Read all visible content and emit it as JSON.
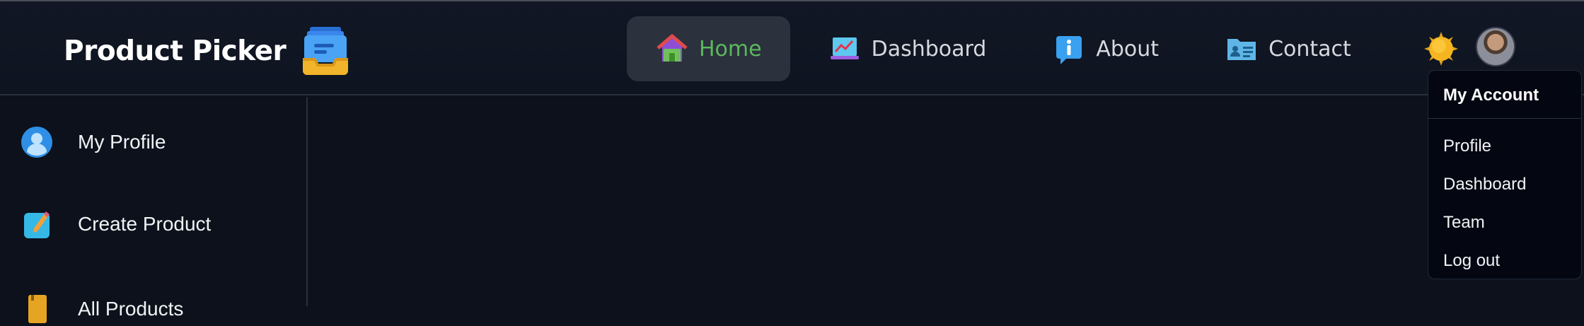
{
  "brand": {
    "title": "Product Picker",
    "icon": "inbox-tray-icon"
  },
  "nav": [
    {
      "label": "Home",
      "icon": "house-icon",
      "active": true
    },
    {
      "label": "Dashboard",
      "icon": "chart-laptop-icon",
      "active": false
    },
    {
      "label": "About",
      "icon": "info-icon",
      "active": false
    },
    {
      "label": "Contact",
      "icon": "contact-card-icon",
      "active": false
    }
  ],
  "account_menu": {
    "title": "My Account",
    "items": [
      "Profile",
      "Dashboard",
      "Team",
      "Log out"
    ]
  },
  "sidebar": {
    "items": [
      {
        "label": "My Profile",
        "icon": "user-icon"
      },
      {
        "label": "Create Product",
        "icon": "edit-note-icon"
      },
      {
        "label": "All Products",
        "icon": "box-icon"
      }
    ]
  },
  "colors": {
    "background": "#0c111c",
    "active_nav_bg": "#2b313d",
    "active_nav_text": "#5cb85c",
    "dropdown_bg": "#040712"
  }
}
